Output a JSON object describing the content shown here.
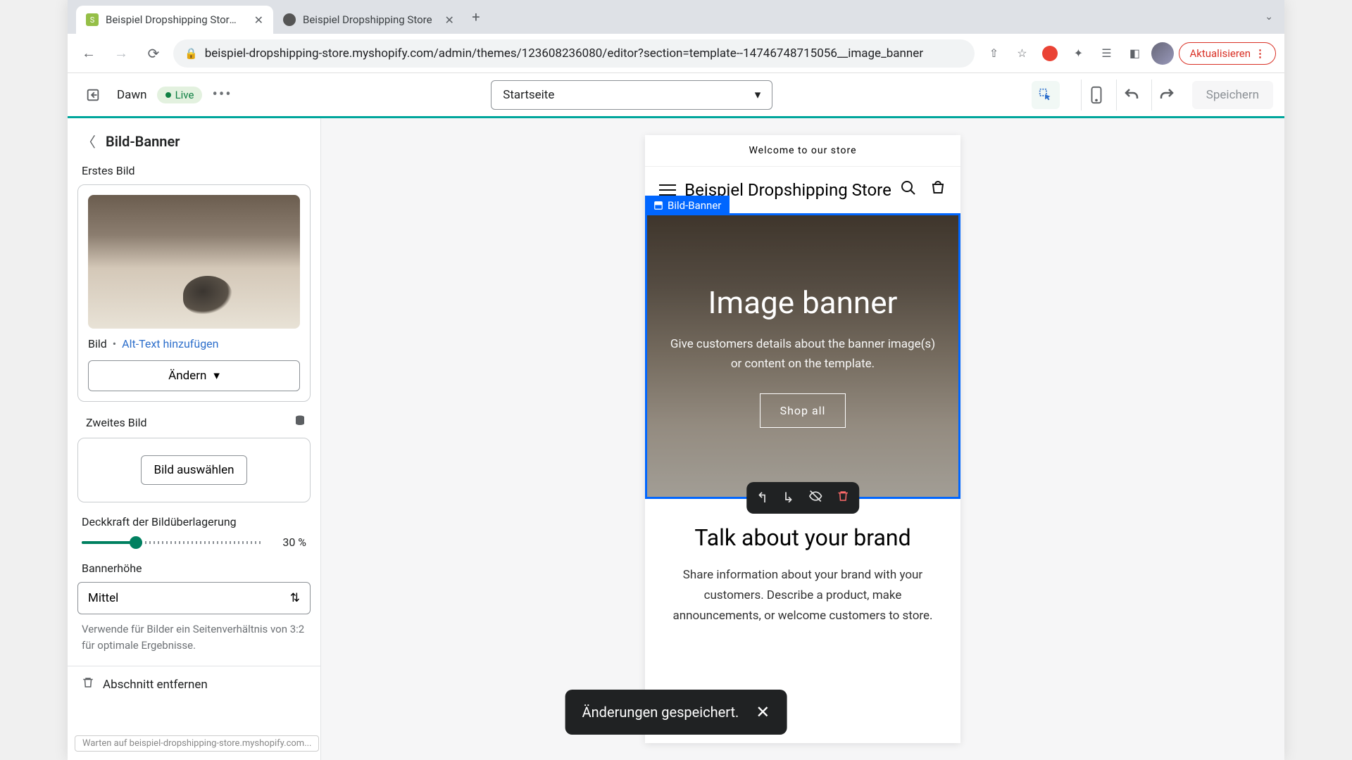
{
  "browser": {
    "tabs": [
      {
        "title": "Beispiel Dropshipping Store · D",
        "active": true
      },
      {
        "title": "Beispiel Dropshipping Store",
        "active": false
      }
    ],
    "url": "beispiel-dropshipping-store.myshopify.com/admin/themes/123608236080/editor?section=template--14746748715056__image_banner",
    "update_label": "Aktualisieren"
  },
  "appbar": {
    "theme": "Dawn",
    "live": "Live",
    "page_selected": "Startseite",
    "save": "Speichern"
  },
  "sidebar": {
    "title": "Bild-Banner",
    "first_image_label": "Erstes Bild",
    "bild_text": "Bild",
    "alt_link": "Alt-Text hinzufügen",
    "change_label": "Ändern",
    "second_image_label": "Zweites Bild",
    "select_image_label": "Bild auswählen",
    "opacity_label": "Deckkraft der Bildüberlagerung",
    "opacity_value": "30 %",
    "height_label": "Bannerhöhe",
    "height_value": "Mittel",
    "height_help": "Verwende für Bilder ein Seitenverhältnis von 3:2 für optimale Ergebnisse.",
    "remove_label": "Abschnitt entfernen"
  },
  "preview": {
    "announcement": "Welcome to our store",
    "store_name": "Beispiel Dropshipping Store",
    "banner_label": "Bild-Banner",
    "banner_heading": "Image banner",
    "banner_text": "Give customers details about the banner image(s) or content on the template.",
    "banner_button": "Shop all",
    "rich_heading": "Talk about your brand",
    "rich_text": "Share information about your brand with your customers. Describe a product, make announcements, or welcome customers to store."
  },
  "toast": {
    "message": "Änderungen gespeichert."
  },
  "status_loading": "Warten auf beispiel-dropshipping-store.myshopify.com..."
}
